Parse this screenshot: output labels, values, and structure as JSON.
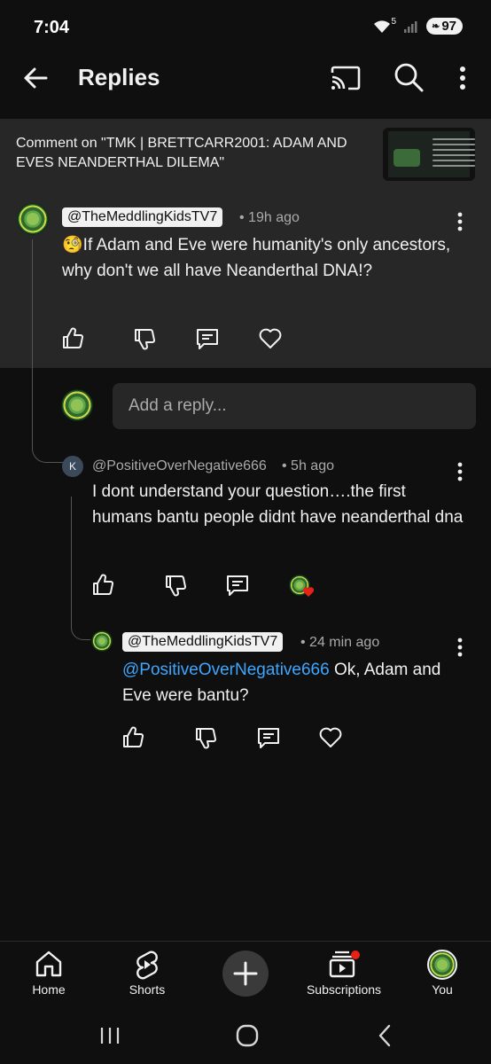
{
  "status": {
    "time": "7:04",
    "battery": "97",
    "network": "5"
  },
  "header": {
    "title": "Replies"
  },
  "context": {
    "text": "Comment on \"TMK |  BRETTCARR2001: ADAM AND EVES NEANDERTHAL DILEMA\""
  },
  "parent_comment": {
    "author": "@TheMeddlingKidsTV7",
    "time": "• 19h ago",
    "emoji": "🧐",
    "text": "If Adam and Eve were humanity's only ancestors, why don't we all have Neanderthal DNA!?"
  },
  "reply_input": {
    "placeholder": "Add a reply..."
  },
  "reply1": {
    "avatar_letter": "K",
    "author": "@PositiveOverNegative666",
    "time": "• 5h ago",
    "text": "I dont understand your question….the first humans bantu people didnt have neanderthal dna"
  },
  "reply2": {
    "author": "@TheMeddlingKidsTV7",
    "time": "• 24 min ago",
    "mention": "@PositiveOverNegative666",
    "text": " Ok, Adam and Eve were bantu?"
  },
  "nav": {
    "home": "Home",
    "shorts": "Shorts",
    "subscriptions": "Subscriptions",
    "you": "You"
  },
  "colors": {
    "link": "#3ea6ff",
    "heart": "#e62117",
    "surface": "#272727",
    "background": "#0f0f0f"
  }
}
